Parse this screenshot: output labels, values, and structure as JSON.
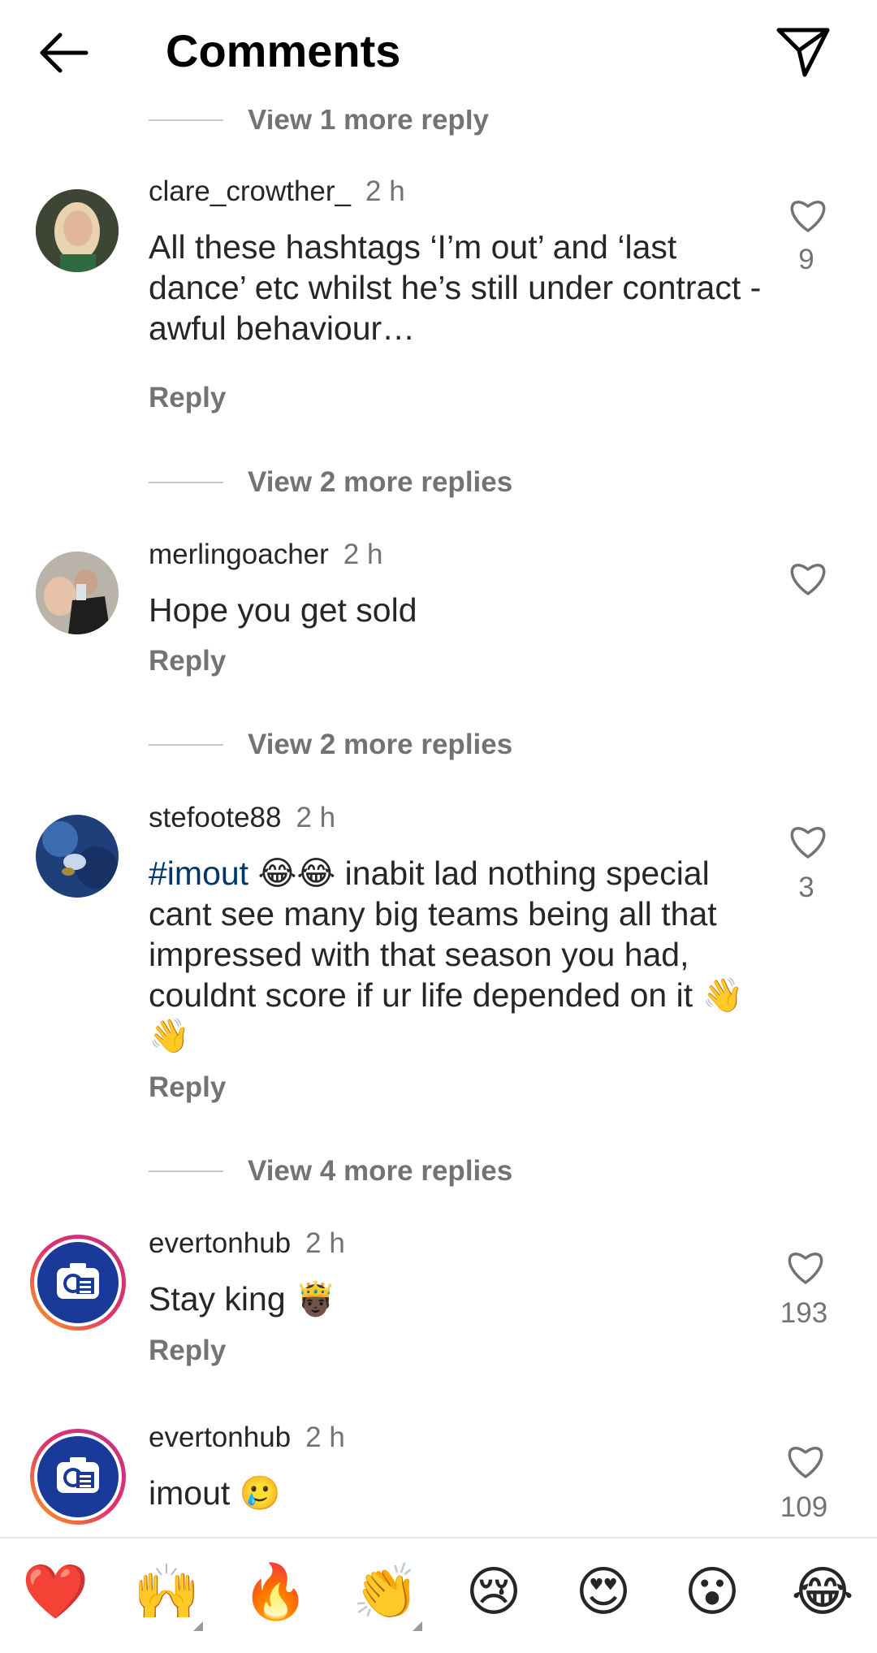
{
  "header": {
    "title": "Comments"
  },
  "top_view_more": "View 1 more reply",
  "comments": [
    {
      "username": "clare_crowther_",
      "time": "2 h",
      "text": "All these hashtags ‘I’m out’ and ‘last dance’ etc whilst he’s still under contract - awful behaviour…",
      "reply": "Reply",
      "likes": "9",
      "view_more": "View 2 more replies"
    },
    {
      "username": "merlingoacher",
      "time": "2 h",
      "text": "Hope you get sold",
      "reply": "Reply",
      "likes": "",
      "view_more": "View 2 more replies"
    },
    {
      "username": "stefoote88",
      "time": "2 h",
      "hashtag": "#imout",
      "text": "😂😂 inabit lad nothing special cant see many big teams being all that impressed with that season you had, couldnt score if ur life depended on it 👋👋",
      "reply": "Reply",
      "likes": "3",
      "view_more": "View 4 more replies"
    },
    {
      "username": "evertonhub",
      "time": "2 h",
      "text": "Stay king 🤴🏿",
      "reply": "Reply",
      "likes": "193"
    },
    {
      "username": "evertonhub",
      "time": "2 h",
      "text": "imout 🥲",
      "likes": "109"
    }
  ],
  "emoji_bar": [
    "❤️",
    "🙌",
    "🔥",
    "👏",
    "😢",
    "😍",
    "😮",
    "😂"
  ],
  "colors": {
    "text": "#262626",
    "secondary": "#737373",
    "hashtag": "#00376b",
    "heart": "#ed4956"
  }
}
